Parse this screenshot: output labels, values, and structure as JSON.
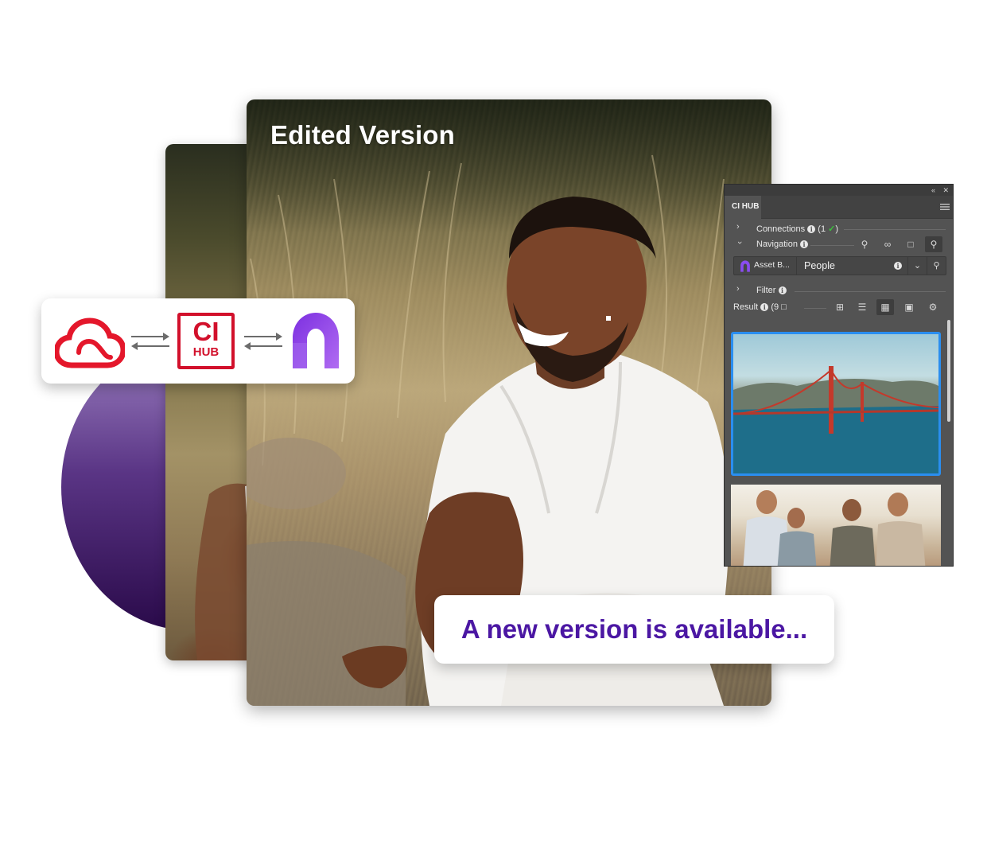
{
  "photo": {
    "title": "Edited Version"
  },
  "logos": {
    "ci_hub_line1": "CI",
    "ci_hub_line2": "HUB"
  },
  "banner": {
    "text": "A new version is available..."
  },
  "panel": {
    "tab": "CI HUB",
    "connections": {
      "label": "Connections",
      "open_paren": "(1",
      "close_paren": ")"
    },
    "navigation": {
      "label": "Navigation"
    },
    "source": {
      "name": "Asset B...",
      "query": "People"
    },
    "filter": {
      "label": "Filter"
    },
    "result": {
      "label": "Result",
      "count": "(9"
    }
  },
  "colors": {
    "banner_text": "#4b17a3",
    "ci_hub_red": "#d2102b",
    "selection_blue": "#2a8ef0",
    "panel_bg": "#535353",
    "check_green": "#3cc23c"
  }
}
